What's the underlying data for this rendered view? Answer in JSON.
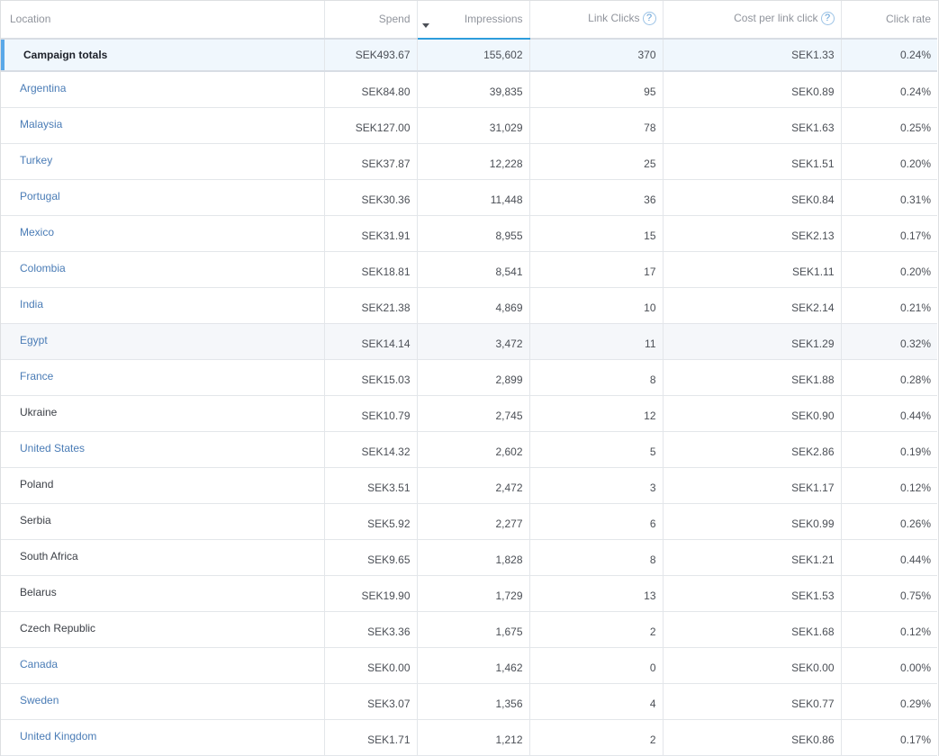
{
  "table": {
    "columns": [
      {
        "label": "Location",
        "help": false
      },
      {
        "label": "Spend",
        "help": false
      },
      {
        "label": "Impressions",
        "help": false,
        "sorted": "desc"
      },
      {
        "label": "Link Clicks",
        "help": true
      },
      {
        "label": "Cost per link click",
        "help": true
      },
      {
        "label": "Click rate",
        "help": false
      }
    ],
    "help_icon_glyph": "?",
    "totals": {
      "location": "Campaign totals",
      "spend": "SEK493.67",
      "impressions": "155,602",
      "link_clicks": "370",
      "cost_per_link_click": "SEK1.33",
      "click_rate": "0.24%"
    },
    "rows": [
      {
        "location": "Argentina",
        "linked": true,
        "spend": "SEK84.80",
        "impressions": "39,835",
        "link_clicks": "95",
        "cost_per_link_click": "SEK0.89",
        "click_rate": "0.24%"
      },
      {
        "location": "Malaysia",
        "linked": true,
        "spend": "SEK127.00",
        "impressions": "31,029",
        "link_clicks": "78",
        "cost_per_link_click": "SEK1.63",
        "click_rate": "0.25%"
      },
      {
        "location": "Turkey",
        "linked": true,
        "spend": "SEK37.87",
        "impressions": "12,228",
        "link_clicks": "25",
        "cost_per_link_click": "SEK1.51",
        "click_rate": "0.20%"
      },
      {
        "location": "Portugal",
        "linked": true,
        "spend": "SEK30.36",
        "impressions": "11,448",
        "link_clicks": "36",
        "cost_per_link_click": "SEK0.84",
        "click_rate": "0.31%"
      },
      {
        "location": "Mexico",
        "linked": true,
        "spend": "SEK31.91",
        "impressions": "8,955",
        "link_clicks": "15",
        "cost_per_link_click": "SEK2.13",
        "click_rate": "0.17%"
      },
      {
        "location": "Colombia",
        "linked": true,
        "spend": "SEK18.81",
        "impressions": "8,541",
        "link_clicks": "17",
        "cost_per_link_click": "SEK1.11",
        "click_rate": "0.20%"
      },
      {
        "location": "India",
        "linked": true,
        "spend": "SEK21.38",
        "impressions": "4,869",
        "link_clicks": "10",
        "cost_per_link_click": "SEK2.14",
        "click_rate": "0.21%"
      },
      {
        "location": "Egypt",
        "linked": true,
        "hover": true,
        "spend": "SEK14.14",
        "impressions": "3,472",
        "link_clicks": "11",
        "cost_per_link_click": "SEK1.29",
        "click_rate": "0.32%"
      },
      {
        "location": "France",
        "linked": true,
        "spend": "SEK15.03",
        "impressions": "2,899",
        "link_clicks": "8",
        "cost_per_link_click": "SEK1.88",
        "click_rate": "0.28%"
      },
      {
        "location": "Ukraine",
        "linked": false,
        "spend": "SEK10.79",
        "impressions": "2,745",
        "link_clicks": "12",
        "cost_per_link_click": "SEK0.90",
        "click_rate": "0.44%"
      },
      {
        "location": "United States",
        "linked": true,
        "spend": "SEK14.32",
        "impressions": "2,602",
        "link_clicks": "5",
        "cost_per_link_click": "SEK2.86",
        "click_rate": "0.19%"
      },
      {
        "location": "Poland",
        "linked": false,
        "spend": "SEK3.51",
        "impressions": "2,472",
        "link_clicks": "3",
        "cost_per_link_click": "SEK1.17",
        "click_rate": "0.12%"
      },
      {
        "location": "Serbia",
        "linked": false,
        "spend": "SEK5.92",
        "impressions": "2,277",
        "link_clicks": "6",
        "cost_per_link_click": "SEK0.99",
        "click_rate": "0.26%"
      },
      {
        "location": "South Africa",
        "linked": false,
        "spend": "SEK9.65",
        "impressions": "1,828",
        "link_clicks": "8",
        "cost_per_link_click": "SEK1.21",
        "click_rate": "0.44%"
      },
      {
        "location": "Belarus",
        "linked": false,
        "spend": "SEK19.90",
        "impressions": "1,729",
        "link_clicks": "13",
        "cost_per_link_click": "SEK1.53",
        "click_rate": "0.75%"
      },
      {
        "location": "Czech Republic",
        "linked": false,
        "spend": "SEK3.36",
        "impressions": "1,675",
        "link_clicks": "2",
        "cost_per_link_click": "SEK1.68",
        "click_rate": "0.12%"
      },
      {
        "location": "Canada",
        "linked": true,
        "spend": "SEK0.00",
        "impressions": "1,462",
        "link_clicks": "0",
        "cost_per_link_click": "SEK0.00",
        "click_rate": "0.00%"
      },
      {
        "location": "Sweden",
        "linked": true,
        "spend": "SEK3.07",
        "impressions": "1,356",
        "link_clicks": "4",
        "cost_per_link_click": "SEK0.77",
        "click_rate": "0.29%"
      },
      {
        "location": "United Kingdom",
        "linked": true,
        "spend": "SEK1.71",
        "impressions": "1,212",
        "link_clicks": "2",
        "cost_per_link_click": "SEK0.86",
        "click_rate": "0.17%"
      }
    ]
  }
}
